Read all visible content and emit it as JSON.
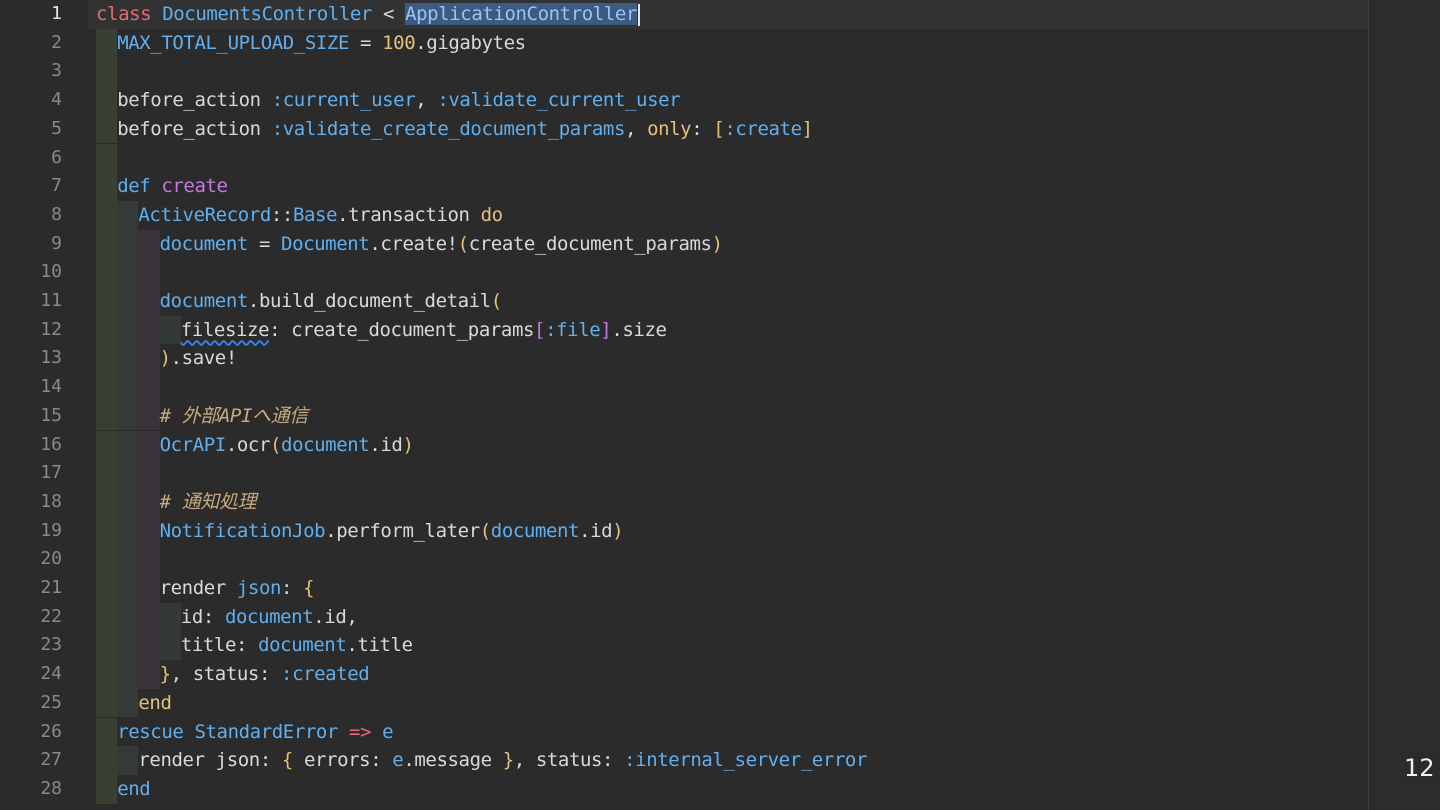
{
  "editor": {
    "active_line": 1,
    "lines": [
      {
        "n": "1",
        "indent": 0,
        "tokens": [
          [
            "kw",
            "class "
          ],
          [
            "cls",
            "DocumentsController"
          ],
          [
            "id",
            " < "
          ],
          [
            "sel",
            "ApplicationController"
          ]
        ]
      },
      {
        "n": "2",
        "indent": 1,
        "tokens": [
          [
            "cls",
            "MAX_TOTAL_UPLOAD_SIZE"
          ],
          [
            "id",
            " = "
          ],
          [
            "num",
            "100"
          ],
          [
            "id",
            ".gigabytes"
          ]
        ]
      },
      {
        "n": "3",
        "indent": 1,
        "tokens": []
      },
      {
        "n": "4",
        "indent": 1,
        "tokens": [
          [
            "id",
            "before_action "
          ],
          [
            "sym",
            ":current_user"
          ],
          [
            "id",
            ", "
          ],
          [
            "sym",
            ":validate_current_user"
          ]
        ]
      },
      {
        "n": "5",
        "indent": 1,
        "tokens": [
          [
            "id",
            "before_action "
          ],
          [
            "sym",
            ":validate_create_document_params"
          ],
          [
            "id",
            ", "
          ],
          [
            "yel",
            "only"
          ],
          [
            "id",
            ": "
          ],
          [
            "yel",
            "["
          ],
          [
            "sym",
            ":create"
          ],
          [
            "yel",
            "]"
          ]
        ]
      },
      {
        "n": "6",
        "indent": 1,
        "tokens": []
      },
      {
        "n": "7",
        "indent": 1,
        "tokens": [
          [
            "def",
            "def "
          ],
          [
            "pur",
            "create"
          ]
        ]
      },
      {
        "n": "8",
        "indent": 2,
        "tokens": [
          [
            "cls",
            "ActiveRecord"
          ],
          [
            "id",
            "::"
          ],
          [
            "cls",
            "Base"
          ],
          [
            "id",
            ".transaction "
          ],
          [
            "yel",
            "do"
          ]
        ]
      },
      {
        "n": "9",
        "indent": 3,
        "tokens": [
          [
            "cls",
            "document"
          ],
          [
            "id",
            " = "
          ],
          [
            "cls",
            "Document"
          ],
          [
            "id",
            ".create!"
          ],
          [
            "yel",
            "("
          ],
          [
            "id",
            "create_document_params"
          ],
          [
            "yel",
            ")"
          ]
        ]
      },
      {
        "n": "10",
        "indent": 3,
        "tokens": []
      },
      {
        "n": "11",
        "indent": 3,
        "tokens": [
          [
            "cls",
            "document"
          ],
          [
            "id",
            ".build_document_detail"
          ],
          [
            "yel",
            "("
          ]
        ]
      },
      {
        "n": "12",
        "indent": 4,
        "tokens": [
          [
            "squig",
            "filesize"
          ],
          [
            "id",
            ": create_document_params"
          ],
          [
            "pur",
            "["
          ],
          [
            "sym",
            ":file"
          ],
          [
            "pur",
            "]"
          ],
          [
            "id",
            ".size"
          ]
        ]
      },
      {
        "n": "13",
        "indent": 3,
        "tokens": [
          [
            "yel",
            ")"
          ],
          [
            "id",
            ".save!"
          ]
        ]
      },
      {
        "n": "14",
        "indent": 3,
        "tokens": []
      },
      {
        "n": "15",
        "indent": 3,
        "tokens": [
          [
            "cm",
            "# 外部APIへ通信"
          ]
        ]
      },
      {
        "n": "16",
        "indent": 3,
        "tokens": [
          [
            "cls",
            "OcrAPI"
          ],
          [
            "id",
            ".ocr"
          ],
          [
            "yel",
            "("
          ],
          [
            "cls",
            "document"
          ],
          [
            "id",
            ".id"
          ],
          [
            "yel",
            ")"
          ]
        ]
      },
      {
        "n": "17",
        "indent": 3,
        "tokens": []
      },
      {
        "n": "18",
        "indent": 3,
        "tokens": [
          [
            "cm",
            "# 通知処理"
          ]
        ]
      },
      {
        "n": "19",
        "indent": 3,
        "tokens": [
          [
            "cls",
            "NotificationJob"
          ],
          [
            "id",
            ".perform_later"
          ],
          [
            "yel",
            "("
          ],
          [
            "cls",
            "document"
          ],
          [
            "id",
            ".id"
          ],
          [
            "yel",
            ")"
          ]
        ]
      },
      {
        "n": "20",
        "indent": 3,
        "tokens": []
      },
      {
        "n": "21",
        "indent": 3,
        "tokens": [
          [
            "id",
            "render "
          ],
          [
            "cls",
            "json"
          ],
          [
            "id",
            ": "
          ],
          [
            "yel",
            "{"
          ]
        ]
      },
      {
        "n": "22",
        "indent": 4,
        "tokens": [
          [
            "id",
            "id: "
          ],
          [
            "cls",
            "document"
          ],
          [
            "id",
            ".id,"
          ]
        ]
      },
      {
        "n": "23",
        "indent": 4,
        "tokens": [
          [
            "id",
            "title: "
          ],
          [
            "cls",
            "document"
          ],
          [
            "id",
            ".title"
          ]
        ]
      },
      {
        "n": "24",
        "indent": 3,
        "tokens": [
          [
            "yel",
            "}"
          ],
          [
            "id",
            ", status: "
          ],
          [
            "sym",
            ":created"
          ]
        ]
      },
      {
        "n": "25",
        "indent": 2,
        "tokens": [
          [
            "yel",
            "end"
          ]
        ]
      },
      {
        "n": "26",
        "indent": 1,
        "tokens": [
          [
            "def",
            "rescue "
          ],
          [
            "cls",
            "StandardError"
          ],
          [
            "op",
            " => "
          ],
          [
            "cls",
            "e"
          ]
        ]
      },
      {
        "n": "27",
        "indent": 2,
        "tokens": [
          [
            "id",
            "render json: "
          ],
          [
            "yel",
            "{ "
          ],
          [
            "id",
            "errors: "
          ],
          [
            "cls",
            "e"
          ],
          [
            "id",
            ".message "
          ],
          [
            "yel",
            "}"
          ],
          [
            "id",
            ", status: "
          ],
          [
            "sym",
            ":internal_server_error"
          ]
        ]
      },
      {
        "n": "28",
        "indent": 1,
        "tokens": [
          [
            "def",
            "end"
          ]
        ]
      }
    ]
  },
  "slide": {
    "page_number": "12"
  }
}
